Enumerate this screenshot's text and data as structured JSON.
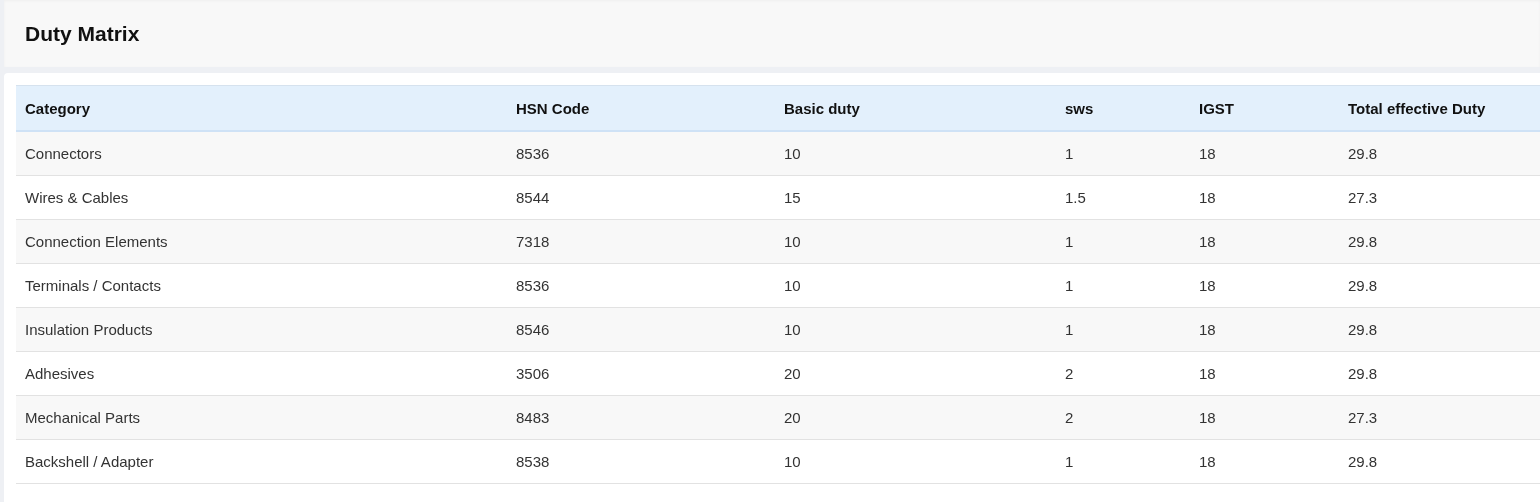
{
  "page": {
    "title": "Duty Matrix"
  },
  "table": {
    "columns": [
      "Category",
      "HSN Code",
      "Basic duty",
      "sws",
      "IGST",
      "Total effective Duty"
    ],
    "rows": [
      [
        "Connectors",
        "8536",
        "10",
        "1",
        "18",
        "29.8"
      ],
      [
        "Wires & Cables",
        "8544",
        "15",
        "1.5",
        "18",
        "27.3"
      ],
      [
        "Connection Elements",
        "7318",
        "10",
        "1",
        "18",
        "29.8"
      ],
      [
        "Terminals / Contacts",
        "8536",
        "10",
        "1",
        "18",
        "29.8"
      ],
      [
        "Insulation Products",
        "8546",
        "10",
        "1",
        "18",
        "29.8"
      ],
      [
        "Adhesives",
        "3506",
        "20",
        "2",
        "18",
        "29.8"
      ],
      [
        "Mechanical Parts",
        "8483",
        "20",
        "2",
        "18",
        "27.3"
      ],
      [
        "Backshell / Adapter",
        "8538",
        "10",
        "1",
        "18",
        "29.8"
      ]
    ]
  }
}
